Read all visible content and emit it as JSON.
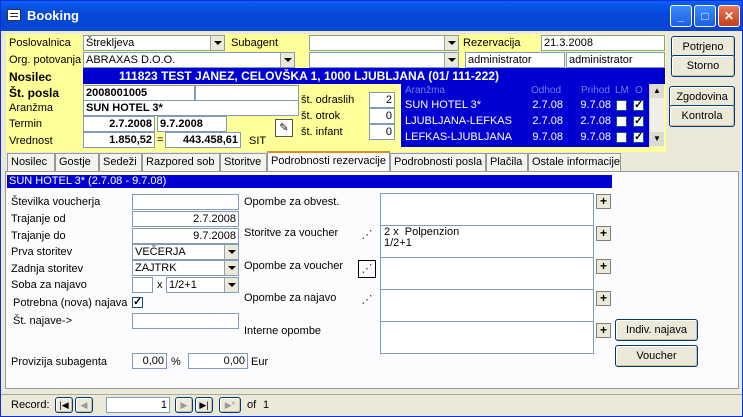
{
  "window": {
    "title": "Booking"
  },
  "header": {
    "poslovalnica_label": "Poslovalnica",
    "poslovalnica_value": "Štrekljeva",
    "subagent_label": "Subagent",
    "subagent_value": "",
    "rezervacija_label": "Rezervacija",
    "rezervacija_value": "21.3.2008",
    "org_label": "Org. potovanja",
    "org_value": "ABRAXAS D.O.O.",
    "user1": "administrator",
    "user2": "administrator"
  },
  "buttons": {
    "potrjeno": "Potrjeno",
    "storno": "Storno",
    "zgodovina": "Zgodovina",
    "kontrola": "Kontrola",
    "indiv_najava": "Indiv. najava",
    "voucher": "Voucher"
  },
  "booking": {
    "nosilec_label": "Nosilec",
    "nosilec_value": "111823 TEST JANEZ, CELOVŠKA 1, 1000 LJUBLJANA (01/ 111-222)",
    "st_posla_label": "Št. posla",
    "st_posla_value": "2008001005",
    "aranzma_label": "Aranžma",
    "aranzma_value": "SUN HOTEL 3*",
    "termin_label": "Termin",
    "termin_from": "2.7.2008",
    "termin_to": "9.7.2008",
    "vrednost_label": "Vrednost",
    "vrednost_1": "1.850,52",
    "vrednost_eq": "=",
    "vrednost_2": "443.458,61",
    "currency": "SIT",
    "odraslih_label": "št. odraslih",
    "odraslih_value": "2",
    "otrok_label": "št. otrok",
    "otrok_value": "0",
    "infant_label": "št. infant",
    "infant_value": "0"
  },
  "arrangements": {
    "headers": [
      "Aranžma",
      "Odhod",
      "Prihod",
      "LM",
      "O"
    ],
    "rows": [
      {
        "name": "SUN HOTEL 3*",
        "odhod": "2.7.08",
        "prihod": "9.7.08",
        "lm": false,
        "o": true
      },
      {
        "name": "LJUBLJANA-LEFKAS",
        "odhod": "2.7.08",
        "prihod": "2.7.08",
        "lm": false,
        "o": true
      },
      {
        "name": "LEFKAS-LJUBLJANA",
        "odhod": "9.7.08",
        "prihod": "9.7.08",
        "lm": false,
        "o": true
      }
    ]
  },
  "tabs": [
    "Nosilec",
    "Gostje",
    "Sedeži",
    "Razpored sob",
    "Storitve",
    "Podrobnosti rezervacije",
    "Podrobnosti posla",
    "Plačila",
    "Ostale informacije"
  ],
  "detail": {
    "section_title": "SUN HOTEL 3* (2.7.08 - 9.7.08)",
    "st_voucherja_label": "Številka voucherja",
    "st_voucherja_value": "",
    "trajanje_od_label": "Trajanje od",
    "trajanje_od_value": "2.7.2008",
    "trajanje_do_label": "Trajanje do",
    "trajanje_do_value": "9.7.2008",
    "prva_label": "Prva storitev",
    "prva_value": "VEČERJA",
    "zadnja_label": "Zadnja storitev",
    "zadnja_value": "ZAJTRK",
    "soba_label": "Soba za najavo",
    "soba_count": "",
    "soba_x": "x",
    "soba_value": "1/2+1",
    "potrebna_label": "Potrebna (nova) najava",
    "st_najave_label": "Št. najave->",
    "st_najave_value": "",
    "provizija_label": "Provizija subagenta",
    "provizija_pct": "0,00",
    "pct_sign": "%",
    "provizija_eur": "0,00",
    "eur_label": "Eur",
    "opombe_obvest_label": "Opombe za obvest.",
    "storitve_voucher_label": "Storitve za voucher",
    "storitve_voucher_value": "2 x  Polpenzion\n1/2+1",
    "opombe_voucher_label": "Opombe za voucher",
    "opombe_najavo_label": "Opombe za najavo",
    "interne_label": "Interne opombe"
  },
  "record_nav": {
    "label": "Record:",
    "current": "1",
    "of_label": "of",
    "total": "1"
  }
}
